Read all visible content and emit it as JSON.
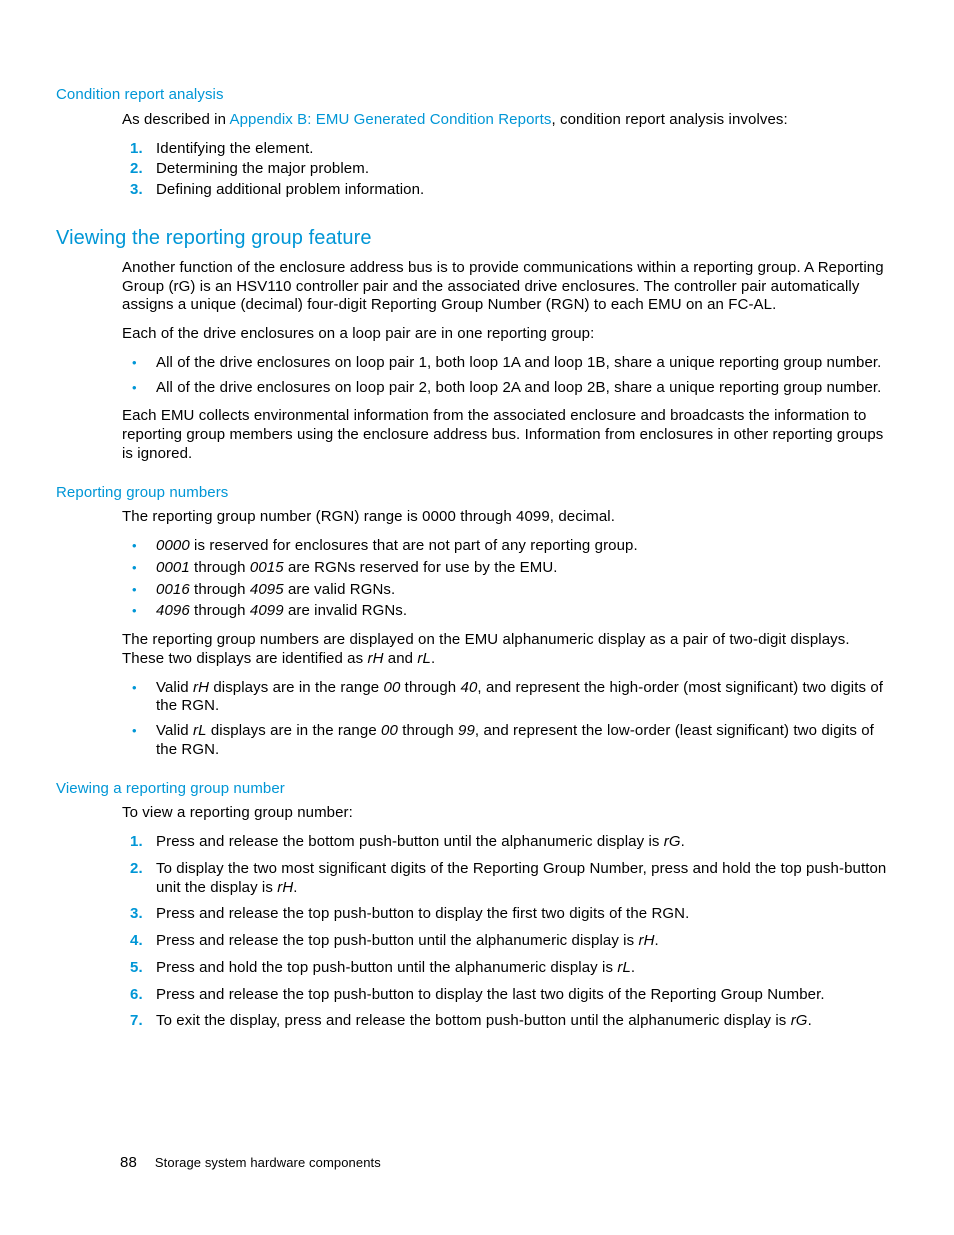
{
  "section1": {
    "heading": "Condition report analysis",
    "intro_pre": "As described in ",
    "intro_link": "Appendix B: EMU Generated Condition Reports",
    "intro_post": ", condition report analysis involves:",
    "items": [
      "Identifying the element.",
      "Determining the major problem.",
      "Defining additional problem information."
    ]
  },
  "section2": {
    "heading": "Viewing the reporting group feature",
    "para1": "Another function of the enclosure address bus is to provide communications within a reporting group. A Reporting Group (rG) is an HSV110 controller pair and the associated drive enclosures. The controller pair automatically assigns a unique (decimal) four-digit Reporting Group Number (RGN) to each EMU on an FC-AL.",
    "para2": "Each of the drive enclosures on a loop pair are in one reporting group:",
    "bullets1": [
      "All of the drive enclosures on loop pair 1, both loop 1A and loop 1B, share a unique reporting group number.",
      "All of the drive enclosures on loop pair 2, both loop 2A and loop 2B, share a unique reporting group number."
    ],
    "para3": "Each EMU collects environmental information from the associated enclosure and broadcasts the information to reporting group members using the enclosure address bus. Information from enclosures in other reporting groups is ignored."
  },
  "section3": {
    "heading": "Reporting group numbers",
    "para1": "The reporting group number (RGN) range is 0000 through 4099, decimal.",
    "bullets1": [
      {
        "i1": "0000",
        "t": " is reserved for enclosures that are not part of any reporting group."
      },
      {
        "i1": "0001",
        "m": " through ",
        "i2": "0015",
        "t": " are RGNs reserved for use by the EMU."
      },
      {
        "i1": "0016",
        "m": " through ",
        "i2": "4095",
        "t": " are valid RGNs."
      },
      {
        "i1": "4096",
        "m": " through ",
        "i2": "4099",
        "t": " are invalid RGNs."
      }
    ],
    "para2_pre": "The reporting group numbers are displayed on the EMU alphanumeric display as a pair of two-digit displays. These two displays are identified as ",
    "para2_i1": "rH",
    "para2_mid": " and ",
    "para2_i2": "rL",
    "para2_post": ".",
    "bullets2": [
      {
        "pre": "Valid ",
        "i1": "rH",
        "mid": " displays are in the range ",
        "i2": "00",
        "mid2": " through ",
        "i3": "40",
        "post": ", and represent the high-order (most significant) two digits of the RGN."
      },
      {
        "pre": "Valid ",
        "i1": "rL",
        "mid": " displays are in the range ",
        "i2": "00",
        "mid2": " through ",
        "i3": "99",
        "post": ", and represent the low-order (least significant) two digits of the RGN."
      }
    ]
  },
  "section4": {
    "heading": "Viewing a reporting group number",
    "intro": "To view a reporting group number:",
    "steps": [
      {
        "pre": "Press and release the bottom push-button until the alphanumeric display is ",
        "i": "rG",
        "post": "."
      },
      {
        "pre": "To display the two most significant digits of the Reporting Group Number, press and hold the top push-button unit the display is ",
        "i": "rH",
        "post": "."
      },
      {
        "pre": "Press and release the top push-button to display the first two digits of the RGN.",
        "i": "",
        "post": ""
      },
      {
        "pre": "Press and release the top push-button until the alphanumeric display is ",
        "i": "rH",
        "post": "."
      },
      {
        "pre": "Press and hold the top push-button until the alphanumeric display is ",
        "i": "rL",
        "post": "."
      },
      {
        "pre": "Press and release the top push-button to display the last two digits of the Reporting Group Number.",
        "i": "",
        "post": ""
      },
      {
        "pre": "To exit the display, press and release the bottom push-button until the alphanumeric display is ",
        "i": "rG",
        "post": "."
      }
    ]
  },
  "footer": {
    "page": "88",
    "title": "Storage system hardware components"
  }
}
